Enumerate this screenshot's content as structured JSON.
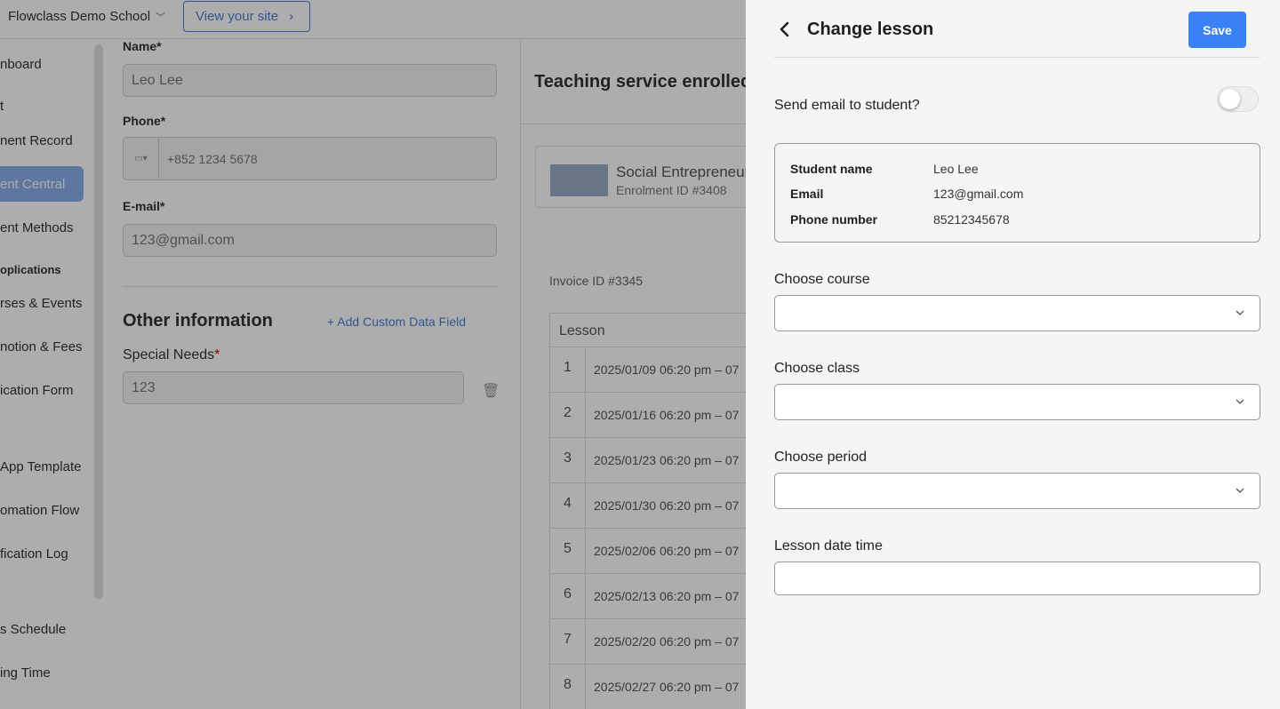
{
  "background": {
    "school_name": "Flowclass Demo School",
    "view_site_label": "View your site",
    "sidebar": {
      "items": [
        {
          "label": "nboard"
        },
        {
          "label": "t"
        },
        {
          "label": "nent Record"
        },
        {
          "label": "ent Central",
          "active": true
        },
        {
          "label": "ent Methods"
        },
        {
          "label": "oplications",
          "heading": true
        },
        {
          "label": "rses & Events"
        },
        {
          "label": "notion & Fees"
        },
        {
          "label": "ication Form"
        },
        {
          "label": "App Template"
        },
        {
          "label": "omation Flow"
        },
        {
          "label": "fication Log"
        },
        {
          "label": "s Schedule"
        },
        {
          "label": "ing Time"
        }
      ]
    },
    "form": {
      "name_label": "Name*",
      "name_value": "Leo Lee",
      "phone_label": "Phone*",
      "phone_placeholder": "+852 1234 5678",
      "email_label": "E-mail*",
      "email_value": "123@gmail.com",
      "other_info_title": "Other information",
      "add_custom_field": "+ Add Custom Data Field",
      "special_needs_label": "Special Needs",
      "special_needs_value": "123"
    },
    "enrolment": {
      "title": "Teaching service enrolled",
      "course_name": "Social Entrepreneurs",
      "enrolment_id": "Enrolment ID #3408",
      "invoice_id": "Invoice ID #3345",
      "table_header": "Lesson",
      "lessons": [
        {
          "num": "1",
          "date": "2025/01/09 06:20 pm – 07"
        },
        {
          "num": "2",
          "date": "2025/01/16 06:20 pm – 07"
        },
        {
          "num": "3",
          "date": "2025/01/23 06:20 pm – 07"
        },
        {
          "num": "4",
          "date": "2025/01/30 06:20 pm – 07"
        },
        {
          "num": "5",
          "date": "2025/02/06 06:20 pm – 07"
        },
        {
          "num": "6",
          "date": "2025/02/13 06:20 pm – 07"
        },
        {
          "num": "7",
          "date": "2025/02/20 06:20 pm – 07"
        },
        {
          "num": "8",
          "date": "2025/02/27 06:20 pm – 07"
        }
      ]
    }
  },
  "drawer": {
    "title": "Change lesson",
    "save_label": "Save",
    "send_email_label": "Send email to student?",
    "send_email_enabled": false,
    "student": {
      "name_key": "Student name",
      "name_value": "Leo Lee",
      "email_key": "Email",
      "email_value": "123@gmail.com",
      "phone_key": "Phone number",
      "phone_value": "85212345678"
    },
    "course_label": "Choose course",
    "class_label": "Choose class",
    "period_label": "Choose period",
    "datetime_label": "Lesson date time"
  },
  "colors": {
    "primary": "#3b82f6",
    "overlay": "rgba(0,0,0,0.32)"
  },
  "icons": [
    "chevron-left-icon",
    "chevron-down-icon",
    "chevron-right-icon",
    "trash-icon",
    "plus-icon"
  ]
}
